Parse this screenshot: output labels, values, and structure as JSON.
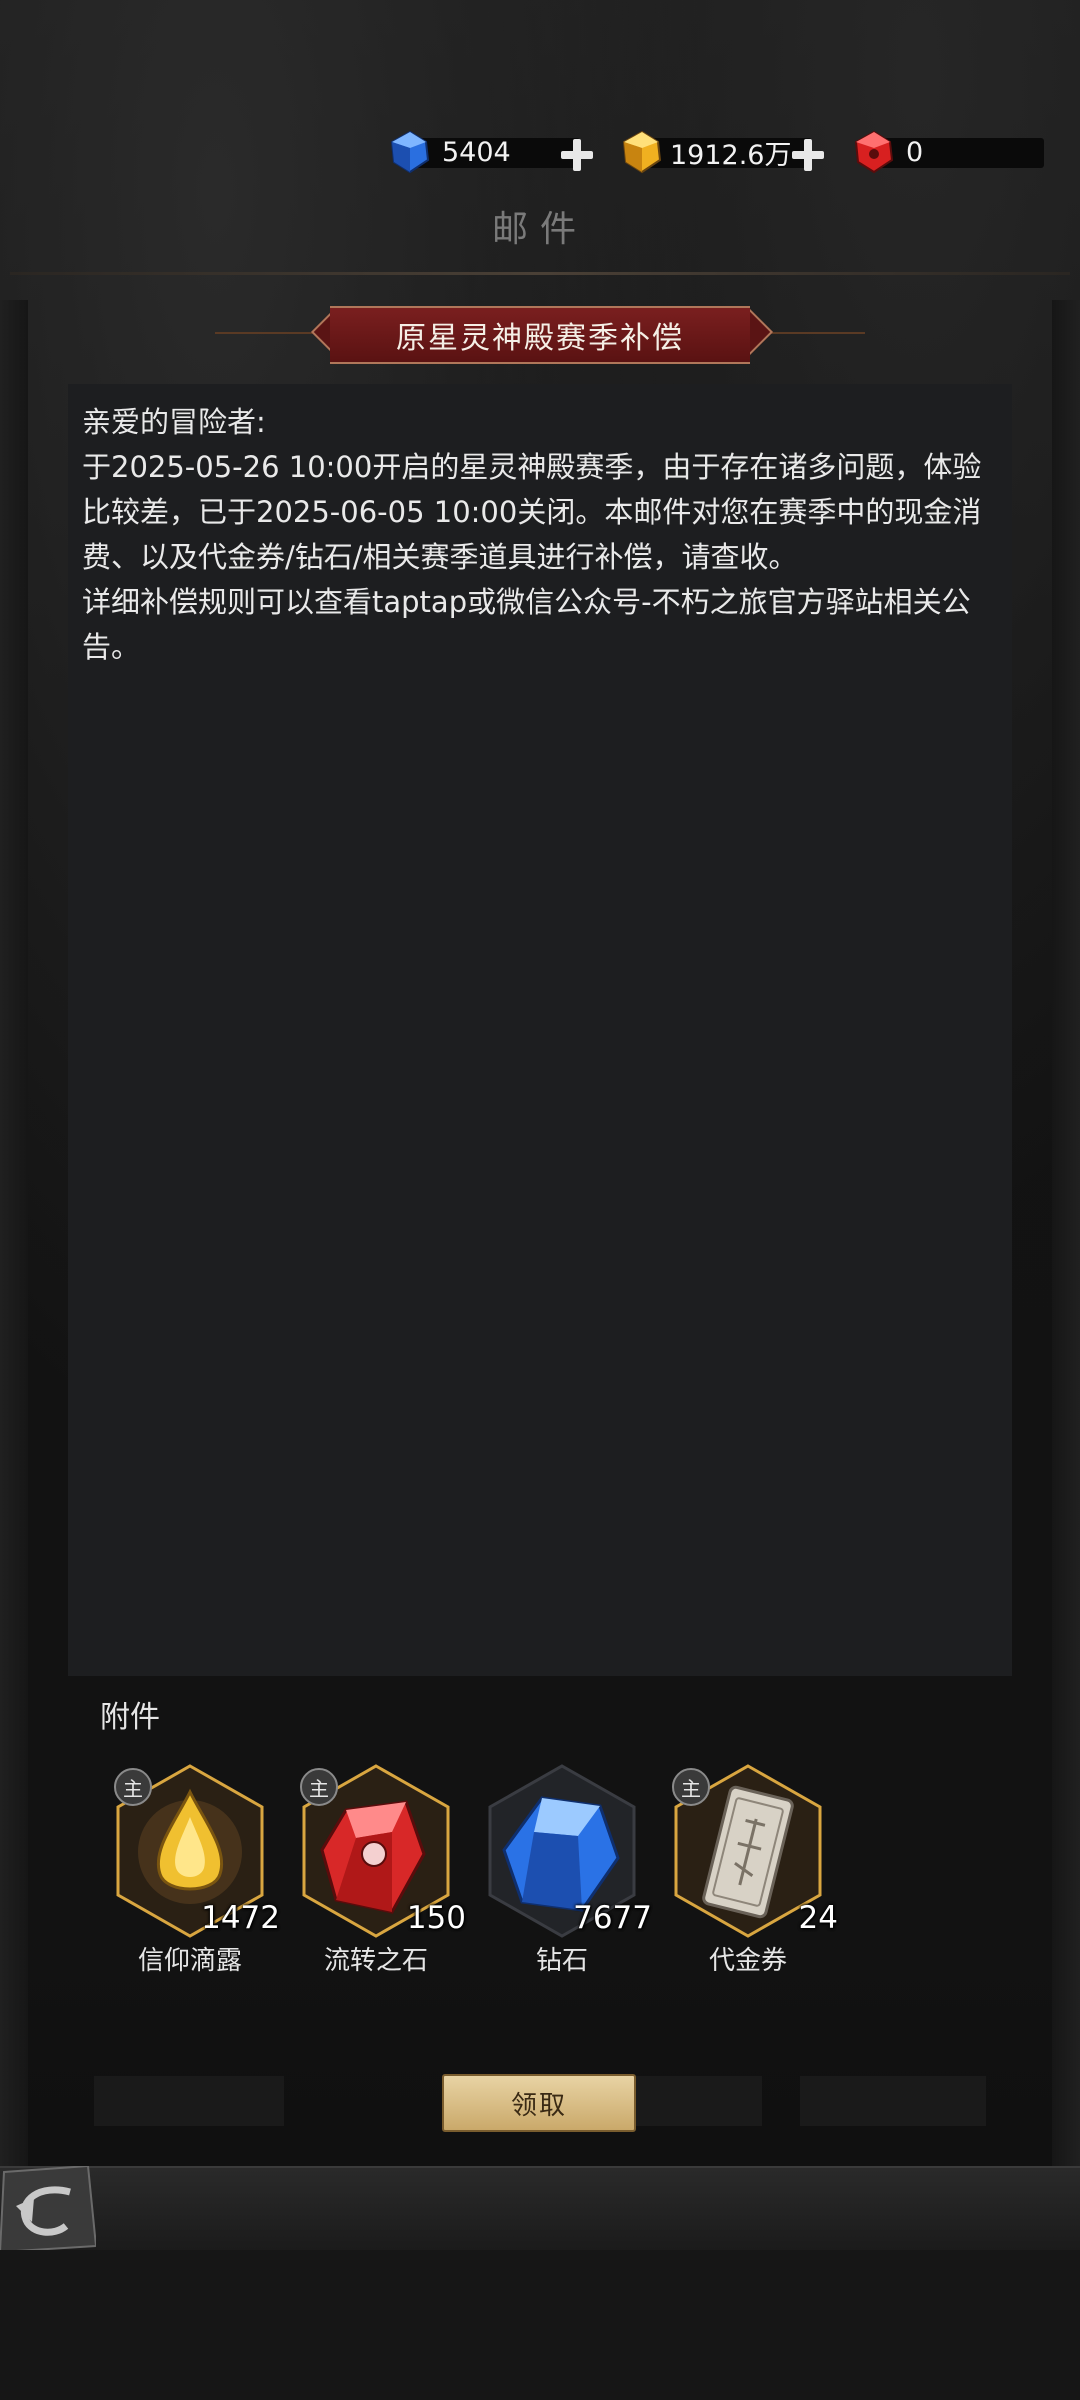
{
  "currency": {
    "diamonds": "5404",
    "gold": "1912.6万",
    "red_gem": "0"
  },
  "page": {
    "title": "邮件"
  },
  "mail": {
    "title": "原星灵神殿赛季补偿",
    "body": [
      "亲爱的冒险者:",
      "于2025-05-26 10:00开启的星灵神殿赛季，由于存在诸多问题，体验比较差，已于2025-06-05 10:00关闭。本邮件对您在赛季中的现金消费、以及代金券/钻石/相关赛季道具进行补偿，请查收。",
      "详细补偿规则可以查看taptap或微信公众号-不朽之旅官方驿站相关公告。"
    ]
  },
  "attachments": {
    "label": "附件",
    "items": [
      {
        "name": "信仰滴露",
        "count": "1472",
        "badge": "主"
      },
      {
        "name": "流转之石",
        "count": "150",
        "badge": "主"
      },
      {
        "name": "钻石",
        "count": "7677",
        "badge": ""
      },
      {
        "name": "代金券",
        "count": "24",
        "badge": "主"
      }
    ]
  },
  "actions": {
    "claim_label": "领取"
  },
  "colors": {
    "gold_border": "#d9a640",
    "banner_red": "#6a1818",
    "claim_bg": "#d9bd84"
  }
}
